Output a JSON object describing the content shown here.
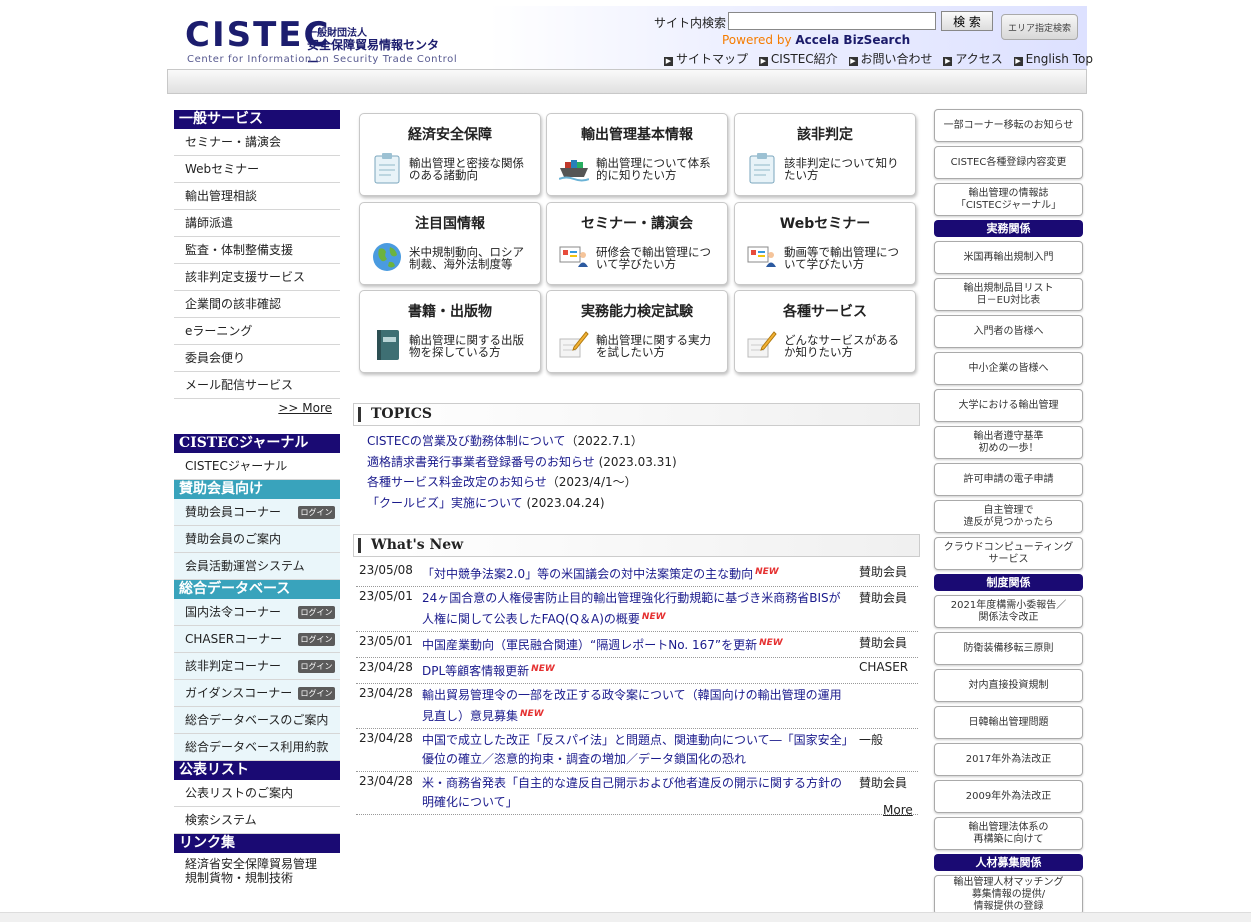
{
  "header": {
    "logo_main": "CISTEC",
    "logo_jp1": "一般財団法人",
    "logo_jp2": "安全保障貿易情報センター",
    "logo_en": "Center for Information on Security Trade Control",
    "search_label": "サイト内検索",
    "search_value": "",
    "search_button": "検 索",
    "area_button": "エリア指定検索",
    "powered_prefix": "Powered by",
    "powered_brand": "Accela BizSearch",
    "links": [
      "サイトマップ",
      "CISTEC紹介",
      "お問い合わせ",
      "アクセス",
      "English Top"
    ]
  },
  "left_nav": {
    "general_head": "一般サービス",
    "general_items": [
      "セミナー・講演会",
      "Webセミナー",
      "輸出管理相談",
      "講師派遣",
      "監査・体制整備支援",
      "該非判定支援サービス",
      "企業間の該非確認",
      "eラーニング",
      "委員会便り",
      "メール配信サービス"
    ],
    "more": ">> More",
    "journal_head": "CISTECジャーナル",
    "journal_item": "CISTECジャーナル",
    "member_head": "賛助会員向け",
    "member_items": [
      "賛助会員コーナー",
      "賛助会員のご案内",
      "会員活動運営システム"
    ],
    "db_head": "総合データベース",
    "db_items": [
      "国内法令コーナー",
      "CHASERコーナー",
      "該非判定コーナー",
      "ガイダンスコーナー",
      "総合データベースのご案内",
      "総合データベース利用約款"
    ],
    "login_badge": "ログイン",
    "list_head": "公表リスト",
    "list_items": [
      "公表リストのご案内",
      "検索システム"
    ],
    "link_head": "リンク集",
    "link_items": [
      "経済省安全保障貿易管理\n規制貨物・規制技術"
    ]
  },
  "tiles": [
    {
      "title": "経済安全保障",
      "desc": "輸出管理と密接な関係のある諸動向",
      "icon": "clipboard-icon"
    },
    {
      "title": "輸出管理基本情報",
      "desc": "輸出管理について体系的に知りたい方",
      "icon": "ship-icon"
    },
    {
      "title": "該非判定",
      "desc": "該非判定について知りたい方",
      "icon": "clipboard-icon"
    },
    {
      "title": "注目国情報",
      "desc": "米中規制動向、ロシア制裁、海外法制度等",
      "icon": "globe-icon"
    },
    {
      "title": "セミナー・講演会",
      "desc": "研修会で輸出管理について学びたい方",
      "icon": "presentation-icon"
    },
    {
      "title": "Webセミナー",
      "desc": "動画等で輸出管理について学びたい方",
      "icon": "presentation-icon"
    },
    {
      "title": "書籍・出版物",
      "desc": "輸出管理に関する出版物を探している方",
      "icon": "book-icon"
    },
    {
      "title": "実務能力検定試験",
      "desc": "輸出管理に関する実力を試したい方",
      "icon": "pencil-icon"
    },
    {
      "title": "各種サービス",
      "desc": "どんなサービスがあるか知りたい方",
      "icon": "pencil-icon"
    }
  ],
  "topics": {
    "head": "TOPICS",
    "items": [
      {
        "text": "CISTECの営業及び勤務体制について",
        "date": "（2022.7.1）"
      },
      {
        "text": "適格請求書発行事業者登録番号のお知らせ",
        "date": " (2023.03.31)"
      },
      {
        "text": "各種サービス料金改定のお知らせ",
        "date": "（2023/4/1～）"
      },
      {
        "text": "「クールビズ」実施について",
        "date": " (2023.04.24)"
      }
    ]
  },
  "whats_new": {
    "head": "What's New",
    "new_badge": "NEW",
    "items": [
      {
        "date": "23/05/08",
        "text": "「対中競争法案2.0」等の米国議会の対中法案策定の主な動向",
        "new": true,
        "cat": "賛助会員"
      },
      {
        "date": "23/05/01",
        "text": "24ヶ国合意の人権侵害防止目的輸出管理強化行動規範に基づき米商務省BISが人権に関して公表したFAQ(Q＆A)の概要",
        "new": true,
        "cat": "賛助会員"
      },
      {
        "date": "23/05/01",
        "text": "中国産業動向（軍民融合関連）“隔週レポートNo. 167”を更新",
        "new": true,
        "cat": "賛助会員"
      },
      {
        "date": "23/04/28",
        "text": "DPL等顧客情報更新",
        "new": true,
        "cat": "CHASER"
      },
      {
        "date": "23/04/28",
        "text": "輸出貿易管理令の一部を改正する政令案について（韓国向けの輸出管理の運用見直し）意見募集",
        "new": true,
        "cat": ""
      },
      {
        "date": "23/04/28",
        "text": "中国で成立した改正「反スパイ法」と問題点、関連動向について―「国家安全」優位の確立／恣意的拘束・調査の増加／データ鎖国化の恐れ",
        "new": false,
        "cat": "一般"
      },
      {
        "date": "23/04/28",
        "text": "米・商務省発表「自主的な違反自己開示および他者違反の開示に関する方針の明確化について」",
        "new": false,
        "cat": "賛助会員"
      }
    ],
    "more": "More"
  },
  "right_col": {
    "top_buttons": [
      "一部コーナー移転のお知らせ",
      "CISTEC各種登録内容変更",
      "輸出管理の情報誌\n「CISTECジャーナル」"
    ],
    "jitsumu_head": "実務関係",
    "jitsumu_buttons": [
      "米国再輸出規制入門",
      "輸出規制品目リスト\n日－EU対比表",
      "入門者の皆様へ",
      "中小企業の皆様へ",
      "大学における輸出管理",
      "輸出者遵守基準\n初めの一歩！",
      "許可申請の電子申請",
      "自主管理で\n違反が見つかったら",
      "クラウドコンピューティング\nサービス"
    ],
    "seido_head": "制度関係",
    "seido_buttons": [
      "2021年度構需小委報告／\n関係法令改正",
      "防衛装備移転三原則",
      "対内直接投資規制",
      "日韓輸出管理問題",
      "2017年外為法改正",
      "2009年外為法改正",
      "輸出管理法体系の\n再構築に向けて"
    ],
    "jinzai_head": "人材募集関係",
    "jinzai_buttons": [
      "輸出管理人材マッチング\n募集情報の提供/\n情報提供の登録"
    ]
  }
}
